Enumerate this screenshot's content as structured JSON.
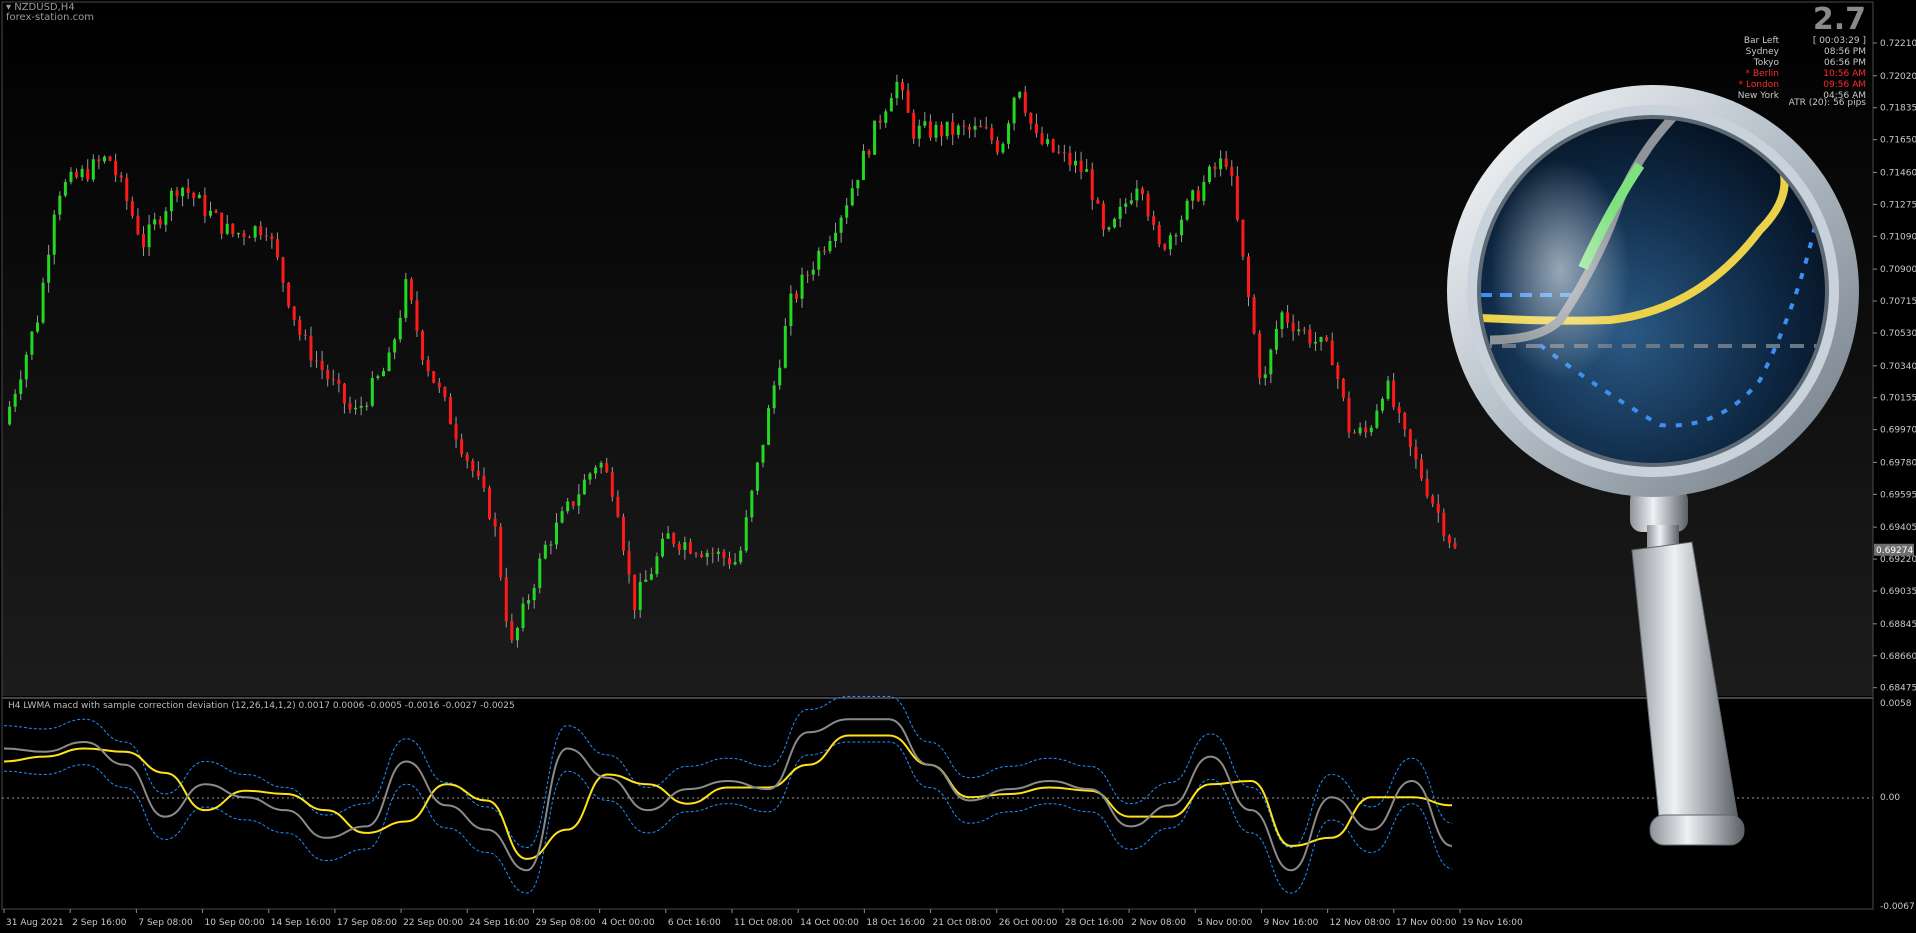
{
  "header": {
    "symbol": "NZDUSD,H4",
    "watermark": "forex-station.com",
    "spread": "2.7"
  },
  "sessions": [
    {
      "name": "Bar Left",
      "value": "[ 00:03:29 ]",
      "color": "#c8c8c8"
    },
    {
      "name": "Sydney",
      "value": "08:56 PM",
      "color": "#c8c8c8"
    },
    {
      "name": "Tokyo",
      "value": "06:56 PM",
      "color": "#c8c8c8"
    },
    {
      "name": "* Berlin",
      "value": "10:56 AM",
      "color": "#ff2a2a"
    },
    {
      "name": "* London",
      "value": "09:56 AM",
      "color": "#ff2a2a"
    },
    {
      "name": "New York",
      "value": "04:56 AM",
      "color": "#c8c8c8"
    }
  ],
  "atr": "ATR (20): 56 pips",
  "indicator": {
    "title": "H4 LWMA macd with sample correction deviation (12,26,14,1,2) 0.0017 0.0006 -0.0005 -0.0016 -0.0027 -0.0025"
  },
  "colors": {
    "background": "#000000",
    "bull": "#22d822",
    "bear": "#ff1a1a",
    "signal": "#ffe21a",
    "macd": "#8a8a8a",
    "bands": "#1e90ff",
    "axis_text": "#c8c8c8"
  },
  "chart_data": [
    {
      "type": "candlestick",
      "title": "NZDUSD,H4",
      "price_ticks": [
        "0.72210",
        "0.72020",
        "0.71835",
        "0.71650",
        "0.71460",
        "0.71275",
        "0.71090",
        "0.70900",
        "0.70715",
        "0.70530",
        "0.70340",
        "0.70155",
        "0.69970",
        "0.69780",
        "0.69595",
        "0.69405",
        "0.69220",
        "0.69035",
        "0.68845",
        "0.68660",
        "0.68475"
      ],
      "ylim": [
        0.6845,
        0.7232
      ],
      "current_price": "0.69274",
      "close_path": [
        {
          "x": "2021-08-31",
          "y": 0.7
        },
        {
          "x": "2021-09-02",
          "y": 0.7065
        },
        {
          "x": "2021-09-03",
          "y": 0.7135
        },
        {
          "x": "2021-09-06",
          "y": 0.7155
        },
        {
          "x": "2021-09-08",
          "y": 0.7105
        },
        {
          "x": "2021-09-10",
          "y": 0.714
        },
        {
          "x": "2021-09-13",
          "y": 0.711
        },
        {
          "x": "2021-09-15",
          "y": 0.7115
        },
        {
          "x": "2021-09-17",
          "y": 0.705
        },
        {
          "x": "2021-09-20",
          "y": 0.7005
        },
        {
          "x": "2021-09-22",
          "y": 0.7035
        },
        {
          "x": "2021-09-23",
          "y": 0.708
        },
        {
          "x": "2021-09-24",
          "y": 0.704
        },
        {
          "x": "2021-09-28",
          "y": 0.6945
        },
        {
          "x": "2021-09-29",
          "y": 0.687
        },
        {
          "x": "2021-10-01",
          "y": 0.693
        },
        {
          "x": "2021-10-04",
          "y": 0.698
        },
        {
          "x": "2021-10-05",
          "y": 0.696
        },
        {
          "x": "2021-10-06",
          "y": 0.6895
        },
        {
          "x": "2021-10-08",
          "y": 0.6935
        },
        {
          "x": "2021-10-12",
          "y": 0.692
        },
        {
          "x": "2021-10-14",
          "y": 0.702
        },
        {
          "x": "2021-10-15",
          "y": 0.707
        },
        {
          "x": "2021-10-18",
          "y": 0.7125
        },
        {
          "x": "2021-10-20",
          "y": 0.7175
        },
        {
          "x": "2021-10-21",
          "y": 0.72
        },
        {
          "x": "2021-10-22",
          "y": 0.717
        },
        {
          "x": "2021-10-26",
          "y": 0.717
        },
        {
          "x": "2021-10-27",
          "y": 0.716
        },
        {
          "x": "2021-10-28",
          "y": 0.72
        },
        {
          "x": "2021-10-29",
          "y": 0.7165
        },
        {
          "x": "2021-11-01",
          "y": 0.7145
        },
        {
          "x": "2021-11-02",
          "y": 0.7105
        },
        {
          "x": "2021-11-04",
          "y": 0.7145
        },
        {
          "x": "2021-11-05",
          "y": 0.71
        },
        {
          "x": "2021-11-08",
          "y": 0.7145
        },
        {
          "x": "2021-11-09",
          "y": 0.7155
        },
        {
          "x": "2021-11-10",
          "y": 0.7085
        },
        {
          "x": "2021-11-11",
          "y": 0.702
        },
        {
          "x": "2021-11-12",
          "y": 0.7065
        },
        {
          "x": "2021-11-15",
          "y": 0.704
        },
        {
          "x": "2021-11-16",
          "y": 0.6995
        },
        {
          "x": "2021-11-17",
          "y": 0.6995
        },
        {
          "x": "2021-11-18",
          "y": 0.7025
        },
        {
          "x": "2021-11-19",
          "y": 0.6995
        },
        {
          "x": "2021-11-22",
          "y": 0.6927
        }
      ],
      "time_ticks": [
        "31 Aug 2021",
        "2 Sep 16:00",
        "7 Sep 08:00",
        "10 Sep 00:00",
        "14 Sep 16:00",
        "17 Sep 08:00",
        "22 Sep 00:00",
        "24 Sep 16:00",
        "29 Sep 08:00",
        "4 Oct 00:00",
        "6 Oct 16:00",
        "11 Oct 08:00",
        "14 Oct 00:00",
        "18 Oct 16:00",
        "21 Oct 08:00",
        "26 Oct 00:00",
        "28 Oct 16:00",
        "2 Nov 08:00",
        "5 Nov 00:00",
        "9 Nov 16:00",
        "12 Nov 08:00",
        "17 Nov 00:00",
        "19 Nov 16:00"
      ]
    },
    {
      "type": "line",
      "title": "H4 LWMA macd with sample correction deviation (12,26,14,1,2)",
      "ylim": [
        -0.0067,
        0.0058
      ],
      "value_ticks": [
        "0.0058",
        "0.00",
        "-0.0067"
      ],
      "series": [
        {
          "values": [
            0.003,
            0.0028,
            0.0034,
            0.002,
            -0.0012,
            0.0008,
            0.0,
            -0.0008,
            -0.0025,
            -0.0018,
            0.0022,
            -0.0005,
            -0.002,
            -0.0045,
            0.003,
            0.0012,
            -0.0008,
            0.0005,
            0.001,
            0.0005,
            0.004,
            0.0048,
            0.0048,
            0.002,
            -0.0002,
            0.0005,
            0.001,
            0.0005,
            -0.0018,
            -0.0005,
            0.0025,
            -0.0008,
            -0.0045,
            0.0,
            -0.002,
            0.001,
            -0.003
          ],
          "color": "#8a8a8a"
        },
        {
          "values": [
            0.0022,
            0.0025,
            0.003,
            0.0028,
            0.0015,
            -0.0008,
            0.0004,
            0.0002,
            -0.0008,
            -0.0022,
            -0.0015,
            0.0008,
            -0.0002,
            -0.0038,
            -0.002,
            0.0014,
            0.0008,
            -0.0004,
            0.0006,
            0.0006,
            0.002,
            0.0038,
            0.0038,
            0.002,
            0.0,
            0.0002,
            0.0006,
            0.0004,
            -0.0012,
            -0.0012,
            0.0008,
            0.001,
            -0.003,
            -0.0025,
            0.0,
            0.0,
            -0.0005
          ],
          "color": "#ffe21a"
        }
      ]
    }
  ]
}
